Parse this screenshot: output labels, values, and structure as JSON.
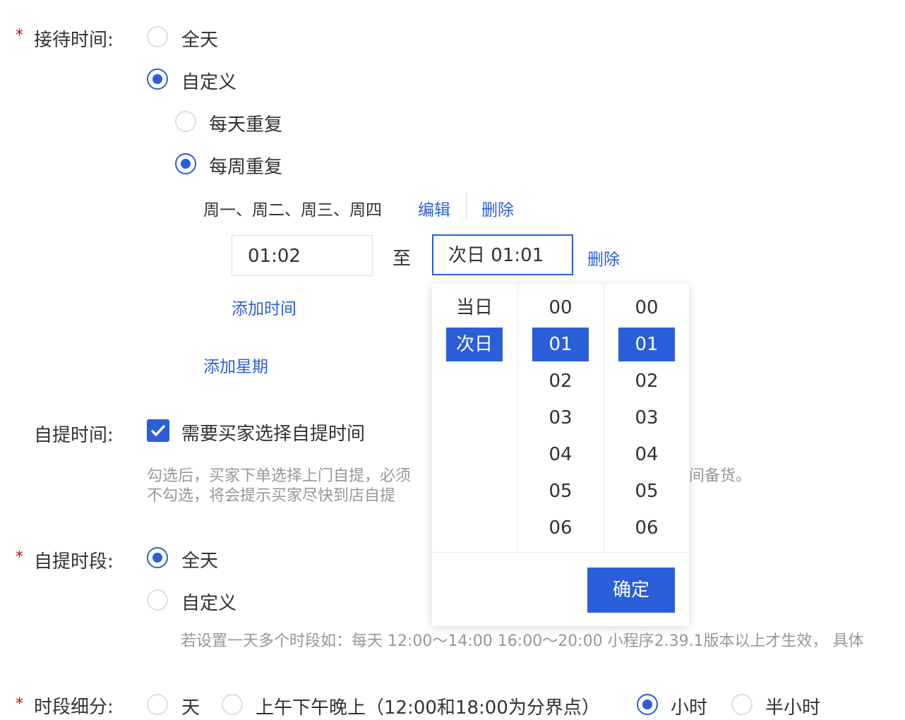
{
  "reception": {
    "required_mark": "*",
    "label": "接待时间:",
    "options": [
      "全天",
      "自定义"
    ],
    "sub_options": [
      "每天重复",
      "每周重复"
    ],
    "weekdays": "周一、周二、周三、周四",
    "edit_link": "编辑",
    "delete_link": "删除",
    "time_start": "01:02",
    "time_to": "至",
    "time_end": "次日 01:01",
    "time_delete": "删除",
    "add_time": "添加时间",
    "add_weekday": "添加星期"
  },
  "picker": {
    "day_column": [
      "当日",
      "次日"
    ],
    "hour_column": [
      "00",
      "01",
      "02",
      "03",
      "04",
      "05",
      "06"
    ],
    "minute_column": [
      "00",
      "01",
      "02",
      "03",
      "04",
      "05",
      "06"
    ],
    "selected_day": "次日",
    "selected_hour": "01",
    "selected_minute": "01",
    "confirm_label": "确定"
  },
  "pickup_time": {
    "label": "自提时间:",
    "checkbox_label": "需要买家选择自提时间",
    "checked": true,
    "hint_line1_left": "勾选后，买家下单选择上门自提，必须",
    "hint_line1_right": "间备货。",
    "hint_line2": "不勾选，将会提示买家尽快到店自提"
  },
  "pickup_period": {
    "required_mark": "*",
    "label": "自提时段:",
    "options": [
      "全天",
      "自定义"
    ],
    "hint": "若设置一天多个时段如：每天 12:00～14:00 16:00～20:00  小程序2.39.1版本以上才生效，  具体"
  },
  "granularity": {
    "required_mark": "*",
    "label": "时段细分:",
    "options": [
      "天",
      "上午下午晚上（12:00和18:00为分界点）",
      "小时",
      "半小时"
    ],
    "selected": "小时"
  },
  "colors": {
    "accent": "#2b5fd9",
    "required": "#d40000",
    "hint": "#969799"
  }
}
